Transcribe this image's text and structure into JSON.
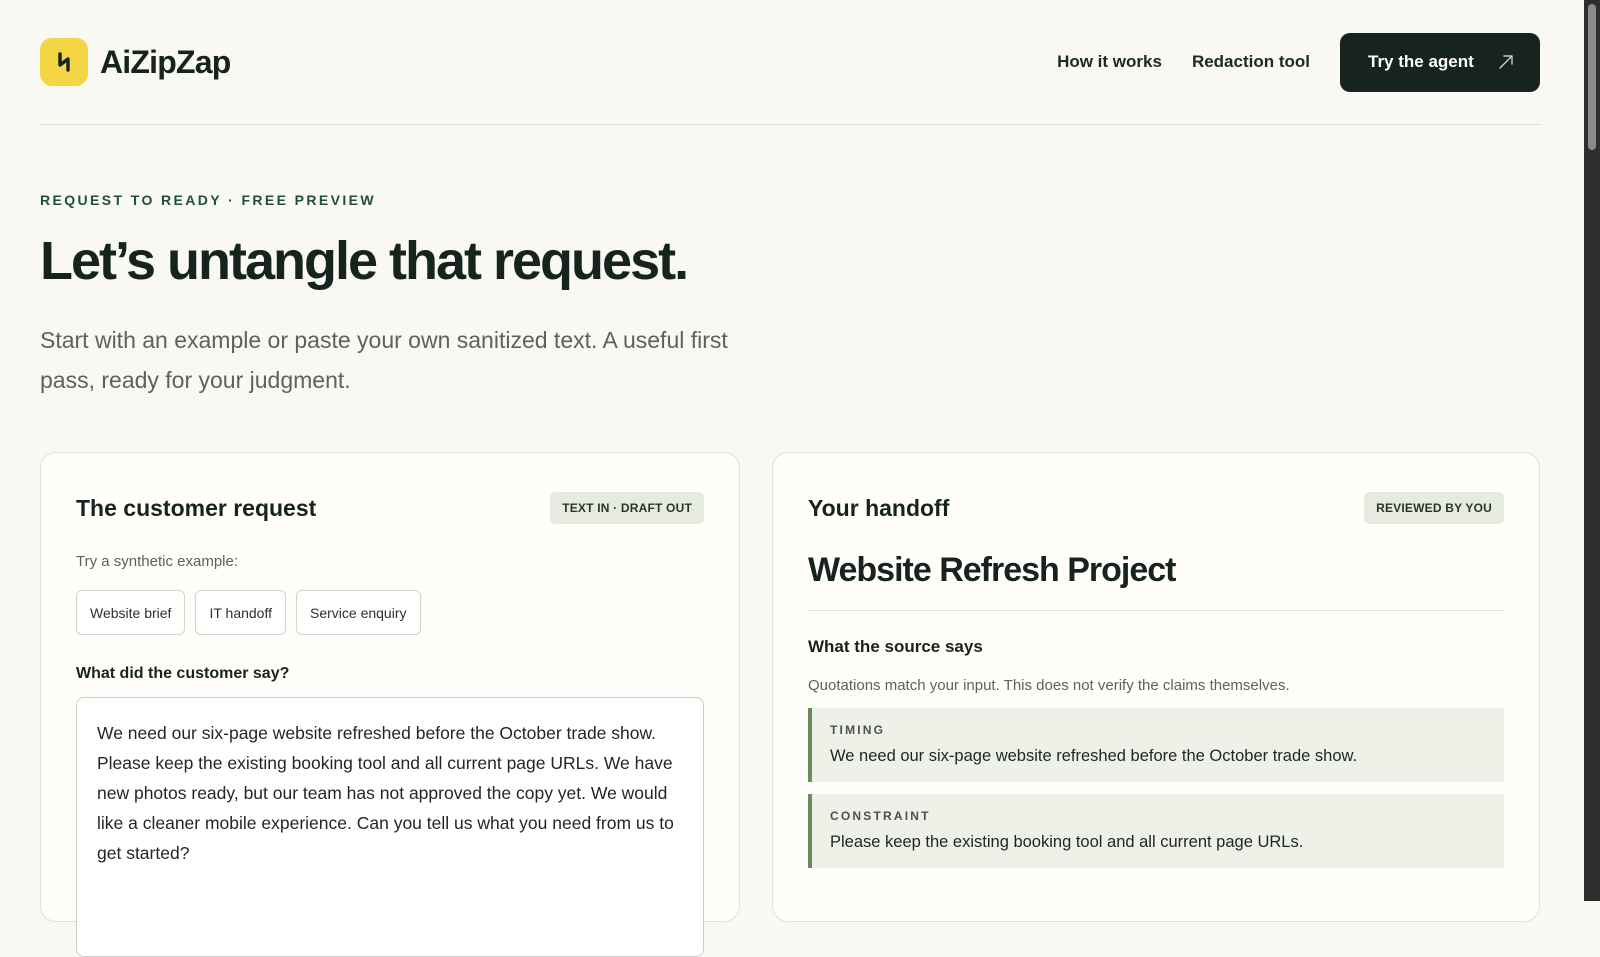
{
  "brand": {
    "name": "AiZipZap",
    "logo_icon": "zigzag-logo-icon",
    "logo_color": "#f3d546"
  },
  "nav": {
    "links": [
      "How it works",
      "Redaction tool"
    ],
    "cta_label": "Try the agent",
    "cta_icon": "arrow-up-right-icon"
  },
  "hero": {
    "eyebrow": "REQUEST TO READY · FREE PREVIEW",
    "title": "Let’s untangle that request.",
    "subtitle": "Start with an example or paste your own sanitized text. A useful first pass, ready for your judgment."
  },
  "request_card": {
    "title": "The customer request",
    "badge": "TEXT IN · DRAFT OUT",
    "examples_hint": "Try a synthetic example:",
    "examples": [
      "Website brief",
      "IT handoff",
      "Service enquiry"
    ],
    "input_label": "What did the customer say?",
    "input_value": "We need our six-page website refreshed before the October trade show. Please keep the existing booking tool and all current page URLs. We have new photos ready, but our team has not approved the copy yet. We would like a cleaner mobile experience. Can you tell us what you need from us to get started?"
  },
  "handoff_card": {
    "title": "Your handoff",
    "badge": "REVIEWED BY YOU",
    "doc_title": "Website Refresh Project",
    "section_title": "What the source says",
    "section_note": "Quotations match your input. This does not verify the claims themselves.",
    "quotes": [
      {
        "label": "TIMING",
        "text": "We need our six-page website refreshed before the October trade show."
      },
      {
        "label": "CONSTRAINT",
        "text": "Please keep the existing booking tool and all current page URLs."
      }
    ]
  },
  "colors": {
    "accent_dark": "#17231e",
    "quote_bar": "#6d8a5f",
    "quote_bg": "#eef1e8"
  }
}
